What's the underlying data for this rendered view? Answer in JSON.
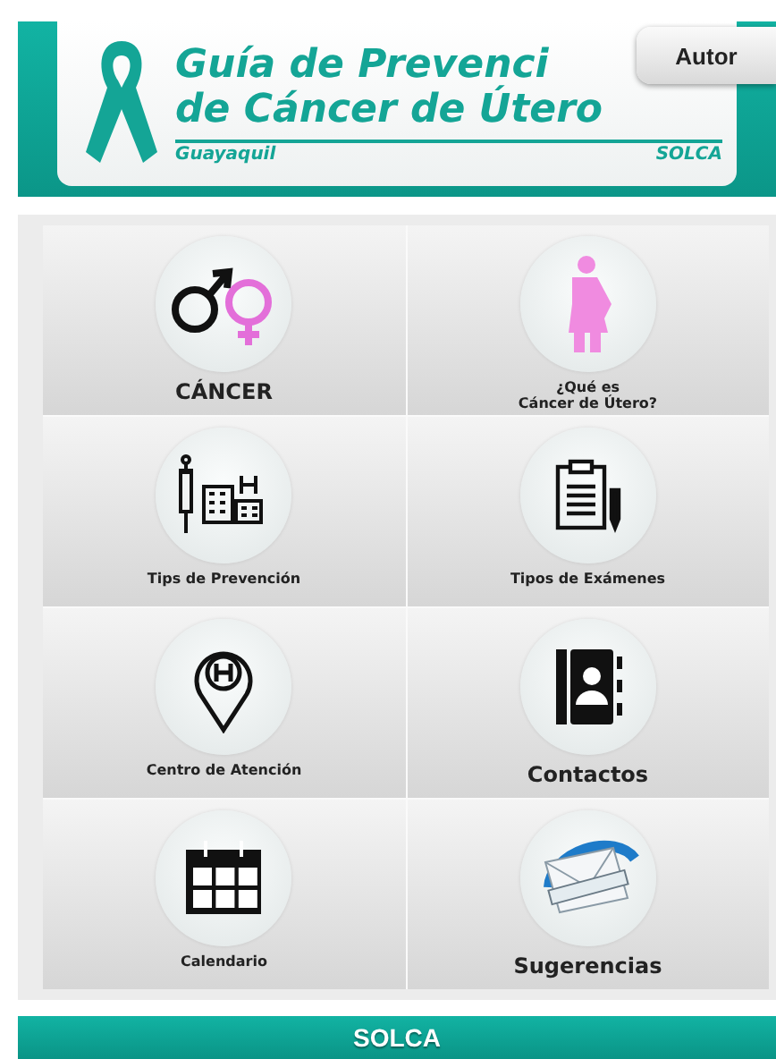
{
  "header": {
    "title_line_1": "Guía de Prevenci",
    "title_line_2": "de Cáncer de Útero",
    "city": "Guayaquil",
    "org": "SOLCA"
  },
  "author_button": {
    "label": "Autor"
  },
  "tiles": [
    {
      "kind": "gender",
      "label": "CÁNCER",
      "prominent": true
    },
    {
      "kind": "woman",
      "label": "¿Qué es\nCáncer de Útero?",
      "prominent": false
    },
    {
      "kind": "prevention",
      "label": "Tips de Prevención",
      "prominent": false
    },
    {
      "kind": "clipboard",
      "label": "Tipos de Exámenes",
      "prominent": false
    },
    {
      "kind": "pin",
      "label": "Centro de Atención",
      "prominent": false
    },
    {
      "kind": "contacts",
      "label": "Contactos",
      "prominent": true
    },
    {
      "kind": "calendar",
      "label": "Calendario",
      "prominent": false
    },
    {
      "kind": "mail",
      "label": "Sugerencias",
      "prominent": true
    }
  ],
  "footer": {
    "label": "SOLCA"
  }
}
